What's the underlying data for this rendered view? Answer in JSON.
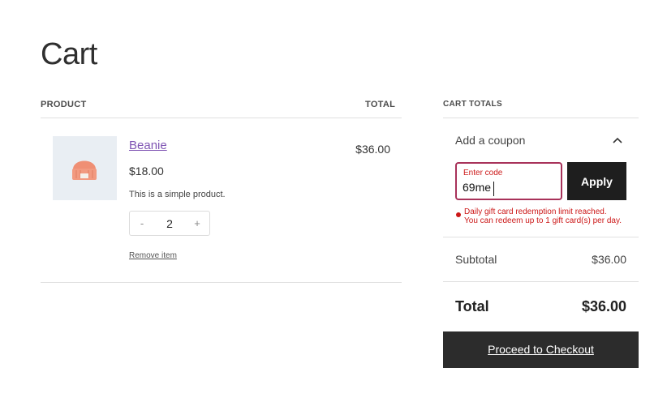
{
  "page": {
    "title": "Cart"
  },
  "table": {
    "headers": {
      "product": "PRODUCT",
      "total": "TOTAL"
    },
    "items": [
      {
        "name": "Beanie",
        "price": "$18.00",
        "description": "This is a simple product.",
        "quantity": "2",
        "qty_minus": "-",
        "qty_plus": "+",
        "line_total": "$36.00",
        "remove_label": "Remove item",
        "thumbnail_icon": "beanie-hat-icon"
      }
    ]
  },
  "totals": {
    "heading": "CART TOTALS",
    "coupon": {
      "toggle_label": "Add a coupon",
      "field_label": "Enter code",
      "value": "69me",
      "apply_label": "Apply",
      "error_line1": "Daily gift card redemption limit reached.",
      "error_line2": "You can redeem up to 1 gift card(s) per day."
    },
    "subtotal_label": "Subtotal",
    "subtotal_value": "$36.00",
    "total_label": "Total",
    "total_value": "$36.00",
    "checkout_label": "Proceed to Checkout"
  },
  "colors": {
    "accent_link": "#7f54b3",
    "error": "#cc1818",
    "field_border": "#a8325a",
    "button_dark": "#1e1e1e"
  }
}
